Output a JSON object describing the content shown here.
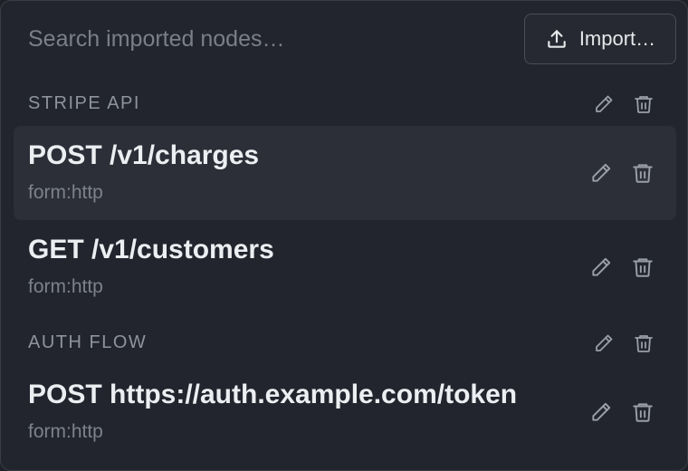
{
  "search": {
    "placeholder": "Search imported nodes…",
    "value": ""
  },
  "import_button": {
    "label": "Import…",
    "icon": "upload-icon"
  },
  "groups": [
    {
      "name": "STRIPE API",
      "nodes": [
        {
          "title": "POST /v1/charges",
          "type": "form:http",
          "selected": true
        },
        {
          "title": "GET /v1/customers",
          "type": "form:http",
          "selected": false
        }
      ]
    },
    {
      "name": "AUTH FLOW",
      "nodes": [
        {
          "title": "POST https://auth.example.com/token",
          "type": "form:http",
          "selected": false
        }
      ]
    }
  ],
  "icons": {
    "edit": "pencil-icon",
    "delete": "trash-icon"
  },
  "colors": {
    "panel_bg": "#22252d",
    "selected_row_bg": "#2c2f38",
    "text_primary": "#eceef1",
    "text_muted": "#7d818a",
    "icon": "#9a9ea6"
  }
}
